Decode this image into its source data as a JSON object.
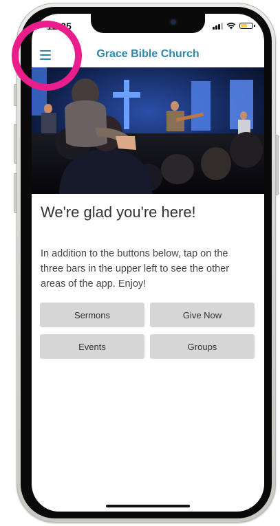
{
  "status_bar": {
    "time": "12:25"
  },
  "header": {
    "title": "Grace Bible Church",
    "menu_icon": "hamburger-menu-icon",
    "accent_color": "#2e86ab"
  },
  "main": {
    "heading": "We're glad you're here!",
    "intro": "In addition to the buttons below, tap on the three bars in the upper left to see the other areas of the app. Enjoy!",
    "buttons": [
      {
        "label": "Sermons"
      },
      {
        "label": "Give Now"
      },
      {
        "label": "Events"
      },
      {
        "label": "Groups"
      }
    ]
  },
  "annotation": {
    "highlight_color": "#e91e8c"
  }
}
